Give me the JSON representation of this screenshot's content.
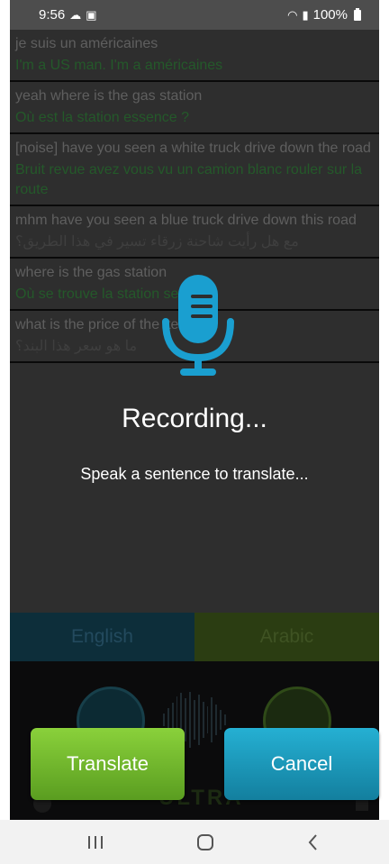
{
  "status_bar": {
    "time": "9:56",
    "battery": "100%",
    "left_icons": [
      "cloud-icon",
      "image-icon"
    ],
    "right_icons": [
      "wifi-icon",
      "signal-icon",
      "battery-icon"
    ]
  },
  "transcript": [
    {
      "source": "je suis un américaines",
      "target": "I'm a US man. I'm a américaines",
      "target_dir": "ltr"
    },
    {
      "source": "yeah where is the gas station",
      "target": "Où est la station essence ?",
      "target_dir": "ltr"
    },
    {
      "source": "[noise] have you seen a white truck drive down the road",
      "target": "Bruit revue avez vous vu un camion blanc rouler sur la route",
      "target_dir": "ltr"
    },
    {
      "source": "mhm have you seen a blue truck drive down this road",
      "target": "مع هل رأيت شاحنة زرقاء تسير في هذا الطريق؟",
      "target_dir": "rtl"
    },
    {
      "source": "where is the gas station",
      "target": "Où se trouve la station service",
      "target_dir": "ltr"
    },
    {
      "source": "what is the price of the item",
      "target": "ما هو سعر هذا البند؟",
      "target_dir": "rtl"
    }
  ],
  "languages": {
    "left": "English",
    "right": "Arabic"
  },
  "app_logo": "ULTRA",
  "recording": {
    "title": "Recording...",
    "subtitle": "Speak a sentence to translate..."
  },
  "buttons": {
    "translate": "Translate",
    "cancel": "Cancel"
  },
  "colors": {
    "mic": "#1a9fd0",
    "translate_button": "#7cc233",
    "cancel_button": "#1ea3c8"
  }
}
